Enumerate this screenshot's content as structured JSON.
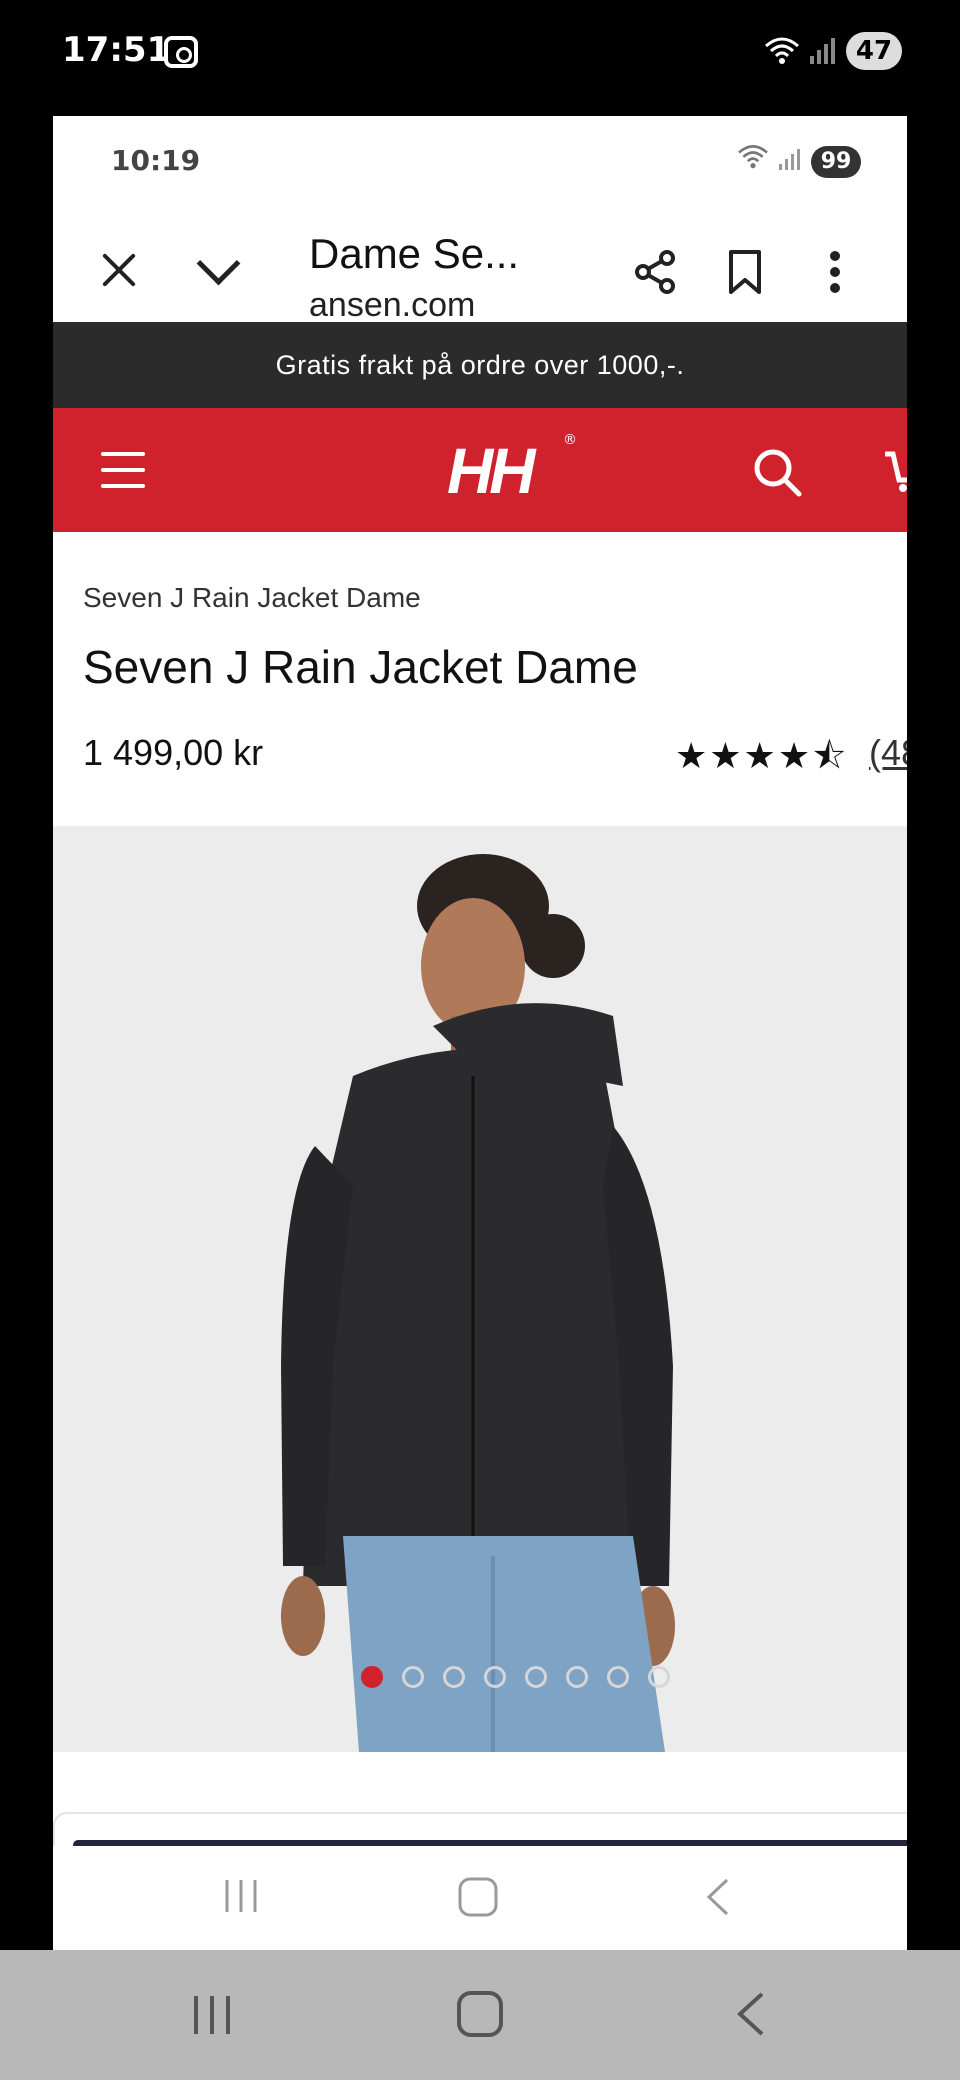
{
  "system_status": {
    "time": "17:51",
    "battery": "47",
    "wifi_label": "5"
  },
  "inner_status": {
    "time": "10:19",
    "battery": "99"
  },
  "browser": {
    "tab_title": "Dame Se...",
    "url": "ansen.com"
  },
  "promo": {
    "text": "Gratis frakt på ordre over 1000,-."
  },
  "header": {
    "logo_text": "HH",
    "logo_registered": "®"
  },
  "product": {
    "breadcrumb": "Seven J Rain Jacket Dame",
    "title": "Seven J Rain Jacket Dame",
    "price": "1 499,00 kr",
    "rating_stars": "★★★★⯪",
    "rating_value": 4.5,
    "review_count": "(48"
  },
  "gallery": {
    "image_count": 8,
    "active_index": 0
  },
  "colors": {
    "brand_red": "#d0222c",
    "promo_bg": "#2b2b2b",
    "image_bg": "#ececec"
  },
  "icons": [
    "close-icon",
    "chevron-down-icon",
    "share-icon",
    "bookmark-icon",
    "more-vertical-icon",
    "menu-icon",
    "search-icon",
    "cart-icon",
    "recents-icon",
    "home-icon",
    "back-icon",
    "wifi-icon",
    "signal-icon",
    "screenshot-icon"
  ]
}
